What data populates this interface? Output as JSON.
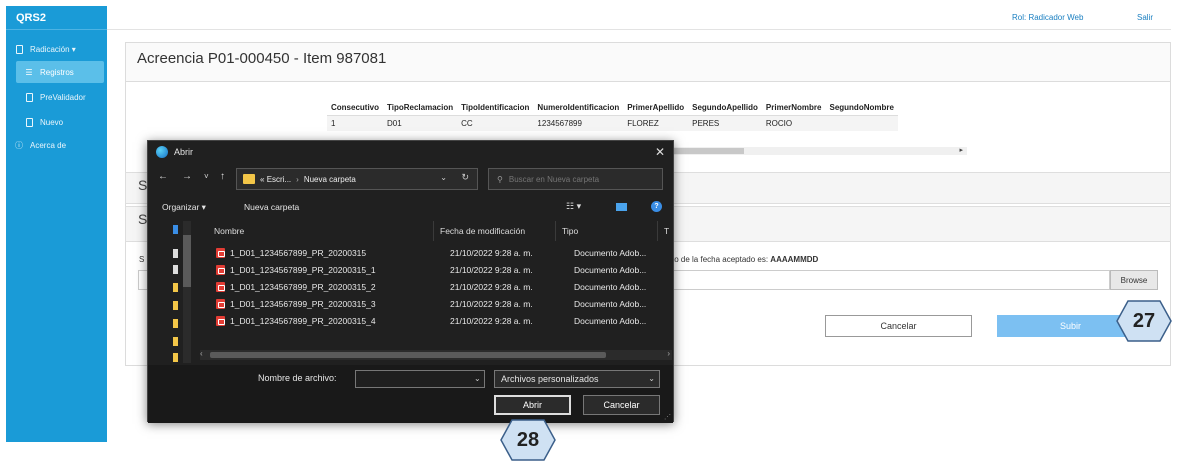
{
  "app": {
    "brand": "QRS2",
    "role_link": "Rol: Radicador Web",
    "logout": "Salir"
  },
  "sidebar": {
    "items": [
      {
        "label": "Radicación ▾",
        "icon": "document-icon"
      },
      {
        "label": "Registros",
        "icon": "list-icon"
      },
      {
        "label": "PreValidador",
        "icon": "document-icon"
      },
      {
        "label": "Nuevo",
        "icon": "document-icon"
      },
      {
        "label": "Acerca de",
        "icon": "info-icon"
      }
    ]
  },
  "main": {
    "title": "Acreencia P01-000450 - Item 987081",
    "table": {
      "columns": [
        "Consecutivo",
        "TipoReclamacion",
        "TipoIdentificacion",
        "NumeroIdentificacion",
        "PrimerApellido",
        "SegundoApellido",
        "PrimerNombre",
        "SegundoNombre"
      ],
      "rows": [
        [
          "1",
          "D01",
          "CC",
          "1234567899",
          "FLOREZ",
          "PERES",
          "ROCIO",
          ""
        ]
      ]
    },
    "section_letter_1": "S",
    "section_letter_2": "S",
    "field_letter": "S",
    "format_hint_prefix": "to de la fecha aceptado es: ",
    "format_hint_value": "AAAAMMDD",
    "browse_label": "Browse",
    "cancel_label": "Cancelar",
    "submit_label": "Subir"
  },
  "badges": {
    "step_27": "27",
    "step_28": "28"
  },
  "dialog": {
    "title": "Abrir",
    "close": "✕",
    "nav_back": "←",
    "nav_forward": "→",
    "nav_recent": "˅",
    "nav_up": "↑",
    "path": {
      "prefix": "«",
      "segment1": "Escri...",
      "separator": "›",
      "segment2": "Nueva carpeta"
    },
    "search_placeholder": "Buscar en Nueva carpeta",
    "organize": "Organizar ▾",
    "new_folder": "Nueva carpeta",
    "columns": {
      "name": "Nombre",
      "modified": "Fecha de modificación",
      "type": "Tipo",
      "extra": "T"
    },
    "files": [
      {
        "name": "1_D01_1234567899_PR_20200315",
        "modified": "21/10/2022 9:28 a. m.",
        "type": "Documento Adob..."
      },
      {
        "name": "1_D01_1234567899_PR_20200315_1",
        "modified": "21/10/2022 9:28 a. m.",
        "type": "Documento Adob..."
      },
      {
        "name": "1_D01_1234567899_PR_20200315_2",
        "modified": "21/10/2022 9:28 a. m.",
        "type": "Documento Adob..."
      },
      {
        "name": "1_D01_1234567899_PR_20200315_3",
        "modified": "21/10/2022 9:28 a. m.",
        "type": "Documento Adob..."
      },
      {
        "name": "1_D01_1234567899_PR_20200315_4",
        "modified": "21/10/2022 9:28 a. m.",
        "type": "Documento Adob..."
      }
    ],
    "filename_label": "Nombre de archivo:",
    "filename_value": "",
    "filter": "Archivos personalizados",
    "open_label": "Abrir",
    "cancel_label": "Cancelar"
  },
  "colors": {
    "sidebar": "#1a9bd7",
    "accent_button": "#7cc0f2",
    "dialog_bg": "#202020",
    "badge_fill": "#cfe1f3"
  }
}
